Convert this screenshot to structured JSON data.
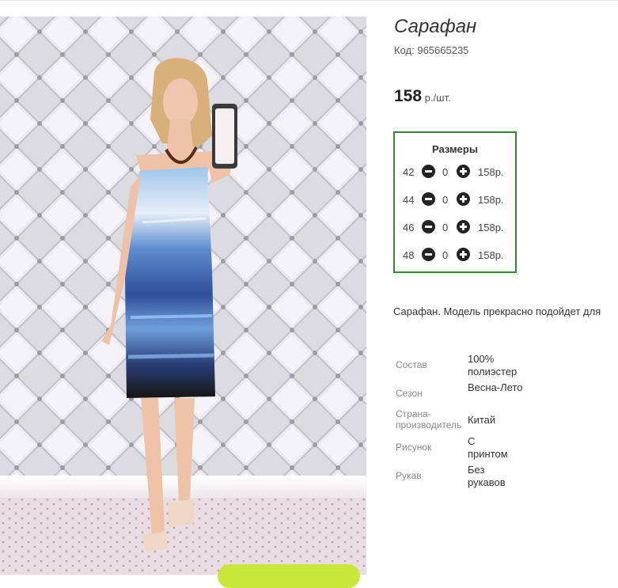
{
  "product": {
    "title": "Сарафан",
    "code_label": "Код:",
    "code_value": "965665235",
    "price_value": "158",
    "price_unit": "р./шт."
  },
  "sizes_panel": {
    "title": "Размеры",
    "accent": "#2e8b2e",
    "rows": [
      {
        "size": "42",
        "qty": "0",
        "price": "158р."
      },
      {
        "size": "44",
        "qty": "0",
        "price": "158р."
      },
      {
        "size": "46",
        "qty": "0",
        "price": "158р."
      },
      {
        "size": "48",
        "qty": "0",
        "price": "158р."
      }
    ]
  },
  "description": "Сарафан. Модель прекрасно подойдет для",
  "properties": [
    {
      "key": "Состав",
      "value": "100% полиэстер"
    },
    {
      "key": "Сезон",
      "value": "Весна-Лето"
    },
    {
      "key": "Страна-производитель",
      "value": "Китай"
    },
    {
      "key": "Рисунок",
      "value": "С принтом"
    },
    {
      "key": "Рукав",
      "value": "Без рукавов"
    }
  ],
  "icons": {
    "decrease": "minus-circle-icon",
    "increase": "plus-circle-icon"
  },
  "colors": {
    "cta": "#c9e63a",
    "price": "#222222"
  }
}
